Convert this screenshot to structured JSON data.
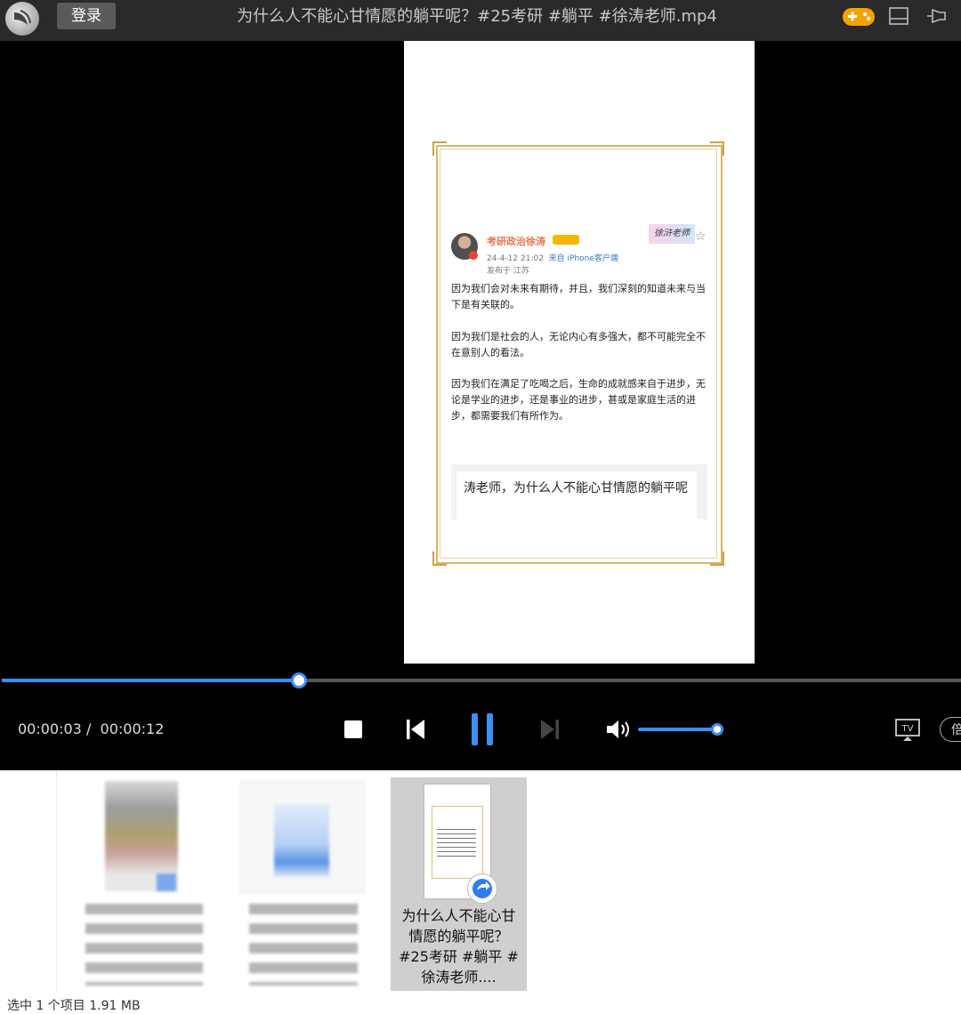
{
  "titlebar": {
    "login_label": "登录",
    "title": "为什么人不能心甘情愿的躺平呢？#25考研 #躺平 #徐涛老师.mp4"
  },
  "post": {
    "author": "考研政治徐涛",
    "time": "24-4-12 21:02",
    "source": "来自 iPhone客户端",
    "location": "发布于 江苏",
    "sticker_text": "徐浒老师",
    "paragraphs": [
      "因为我们会对未来有期待，并且，我们深刻的知道未来与当下是有关联的。",
      "因为我们是社会的人，无论内心有多强大，都不可能完全不在意别人的看法。",
      "因为我们在满足了吃喝之后，生命的成就感来自于进步，无论是学业的进步，还是事业的进步，甚或是家庭生活的进步，都需要我们有所作为。"
    ],
    "reply": "涛老师，为什么人不能心甘情愿的躺平呢"
  },
  "player": {
    "current_time": "00:00:03",
    "separator": "/",
    "total_time": "00:00:12",
    "progress_fraction": 0.25,
    "volume_fraction": 1.0,
    "speed_label": "倍",
    "accent_color": "#3d8ff3"
  },
  "explorer": {
    "selected_file_name": "为什么人不能心甘情愿的躺平呢？#25考研 #躺平 #徐涛老师....",
    "status_bar": "选中 1 个项目  1.91 MB"
  }
}
